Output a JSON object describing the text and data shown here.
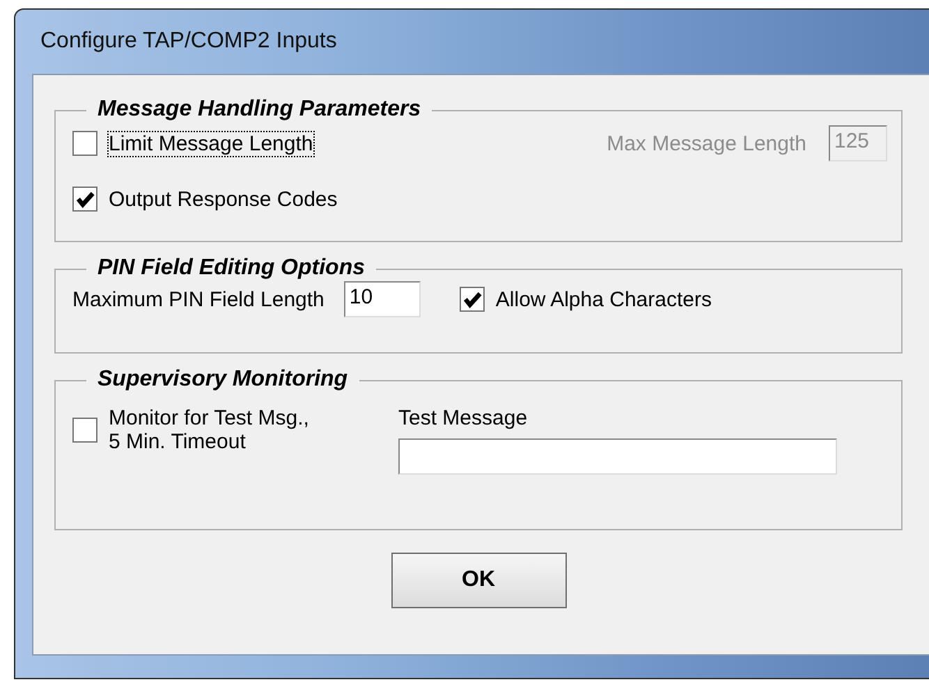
{
  "window": {
    "title": "Configure TAP/COMP2 Inputs"
  },
  "message_handling": {
    "title": "Message Handling Parameters",
    "limit_length": {
      "label": "Limit Message Length",
      "checked": false,
      "focused": true
    },
    "max_length": {
      "label": "Max Message Length",
      "value": "125",
      "disabled": true
    },
    "output_codes": {
      "label": "Output Response Codes",
      "checked": true
    }
  },
  "pin_options": {
    "title": "PIN Field Editing Options",
    "max_pin": {
      "label": "Maximum PIN Field Length",
      "value": "10"
    },
    "allow_alpha": {
      "label": "Allow Alpha Characters",
      "checked": true
    }
  },
  "supervisory": {
    "title": "Supervisory Monitoring",
    "monitor": {
      "label_lines": [
        "Monitor for Test Msg.,",
        "5 Min. Timeout"
      ],
      "checked": false
    },
    "test_message": {
      "label": "Test Message"
    }
  },
  "buttons": [
    "OK"
  ]
}
